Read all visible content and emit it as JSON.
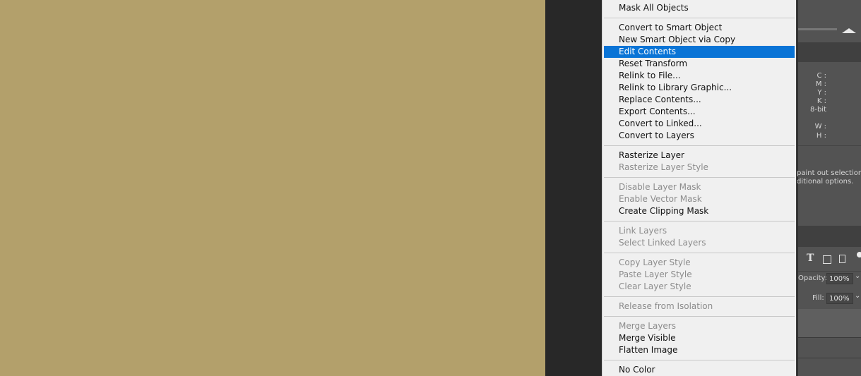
{
  "menu": {
    "items": [
      {
        "label": "Mask All Objects",
        "enabled": true
      },
      {
        "sep": true
      },
      {
        "label": "Convert to Smart Object",
        "enabled": true
      },
      {
        "label": "New Smart Object via Copy",
        "enabled": true
      },
      {
        "label": "Edit Contents",
        "enabled": true,
        "highlighted": true
      },
      {
        "label": "Reset Transform",
        "enabled": true
      },
      {
        "label": "Relink to File...",
        "enabled": true
      },
      {
        "label": "Relink to Library Graphic...",
        "enabled": true
      },
      {
        "label": "Replace Contents...",
        "enabled": true
      },
      {
        "label": "Export Contents...",
        "enabled": true
      },
      {
        "label": "Convert to Linked...",
        "enabled": true
      },
      {
        "label": "Convert to Layers",
        "enabled": true
      },
      {
        "sep": true
      },
      {
        "label": "Rasterize Layer",
        "enabled": true
      },
      {
        "label": "Rasterize Layer Style",
        "enabled": false
      },
      {
        "sep": true
      },
      {
        "label": "Disable Layer Mask",
        "enabled": false
      },
      {
        "label": "Enable Vector Mask",
        "enabled": false
      },
      {
        "label": "Create Clipping Mask",
        "enabled": true
      },
      {
        "sep": true
      },
      {
        "label": "Link Layers",
        "enabled": false
      },
      {
        "label": "Select Linked Layers",
        "enabled": false
      },
      {
        "sep": true
      },
      {
        "label": "Copy Layer Style",
        "enabled": false
      },
      {
        "label": "Paste Layer Style",
        "enabled": false
      },
      {
        "label": "Clear Layer Style",
        "enabled": false
      },
      {
        "sep": true
      },
      {
        "label": "Release from Isolation",
        "enabled": false
      },
      {
        "sep": true
      },
      {
        "label": "Merge Layers",
        "enabled": false
      },
      {
        "label": "Merge Visible",
        "enabled": true
      },
      {
        "label": "Flatten Image",
        "enabled": true
      },
      {
        "sep": true
      },
      {
        "label": "No Color",
        "enabled": true
      }
    ]
  },
  "info": {
    "c": "C :",
    "m": "M :",
    "y": "Y :",
    "k": "K :",
    "bit": "8-bit",
    "w": "W :",
    "h": "H :",
    "hint1": "paint out selection.",
    "hint2": "ditional options."
  },
  "layers": {
    "opacity_label": "Opacity:",
    "opacity": "100%",
    "fill_label": "Fill:",
    "fill": "100%"
  },
  "colors": {
    "canvas": "#b3a06b",
    "highlight": "#0a74d6"
  }
}
